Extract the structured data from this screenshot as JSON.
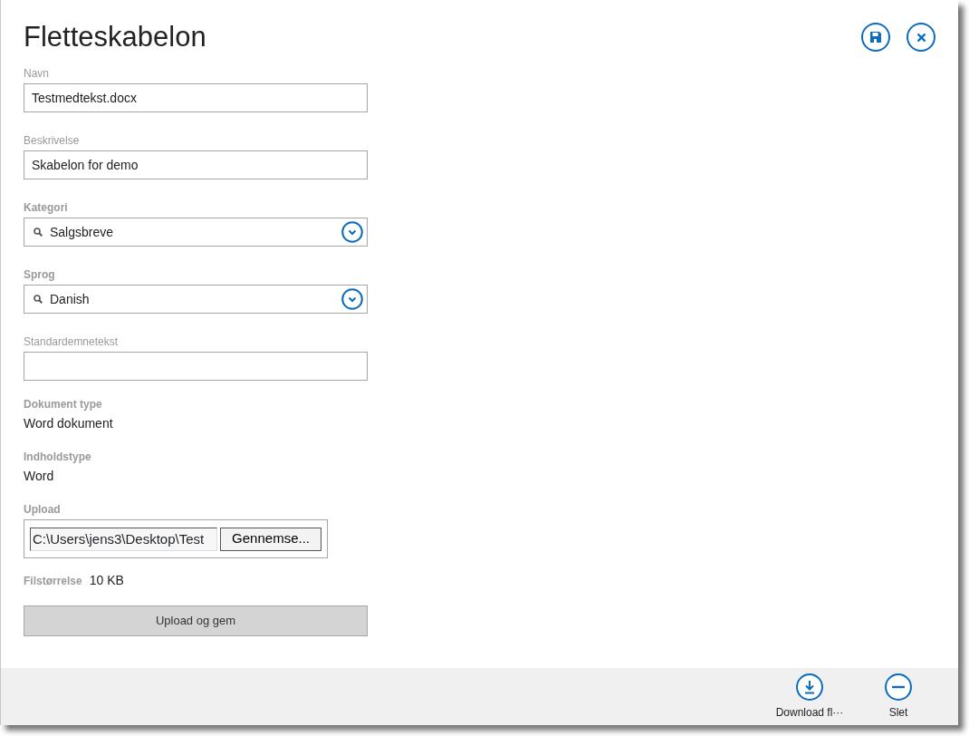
{
  "title": "Fletteskabelon",
  "header_buttons": [
    {
      "kind": "save"
    },
    {
      "kind": "close"
    }
  ],
  "fields": [
    {
      "kind": "text",
      "label": "Navn",
      "value": "Testmedtekst.docx"
    },
    {
      "kind": "text",
      "label": "Beskrivelse",
      "value": "Skabelon for demo"
    },
    {
      "kind": "lookup",
      "label": "Kategori",
      "value": "Salgsbreve"
    },
    {
      "kind": "lookup",
      "label": "Sprog",
      "value": "Danish"
    },
    {
      "kind": "text",
      "label": "Standardemnetekst"
    },
    {
      "kind": "static",
      "label": "Dokument type",
      "value": "Word dokument"
    },
    {
      "kind": "static",
      "label": "Indholdstype",
      "value": "Word"
    },
    {
      "kind": "file",
      "label": "Upload",
      "value": "C:\\Users\\jens3\\Desktop\\Test",
      "button": "Gennemse..."
    },
    {
      "kind": "inline",
      "label": "Filstørrelse",
      "value": "10 KB"
    }
  ],
  "upload_button": "Upload og gem",
  "command_bar": [
    {
      "kind": "download",
      "label": "Download fl···"
    },
    {
      "kind": "delete",
      "label": "Slet"
    }
  ]
}
